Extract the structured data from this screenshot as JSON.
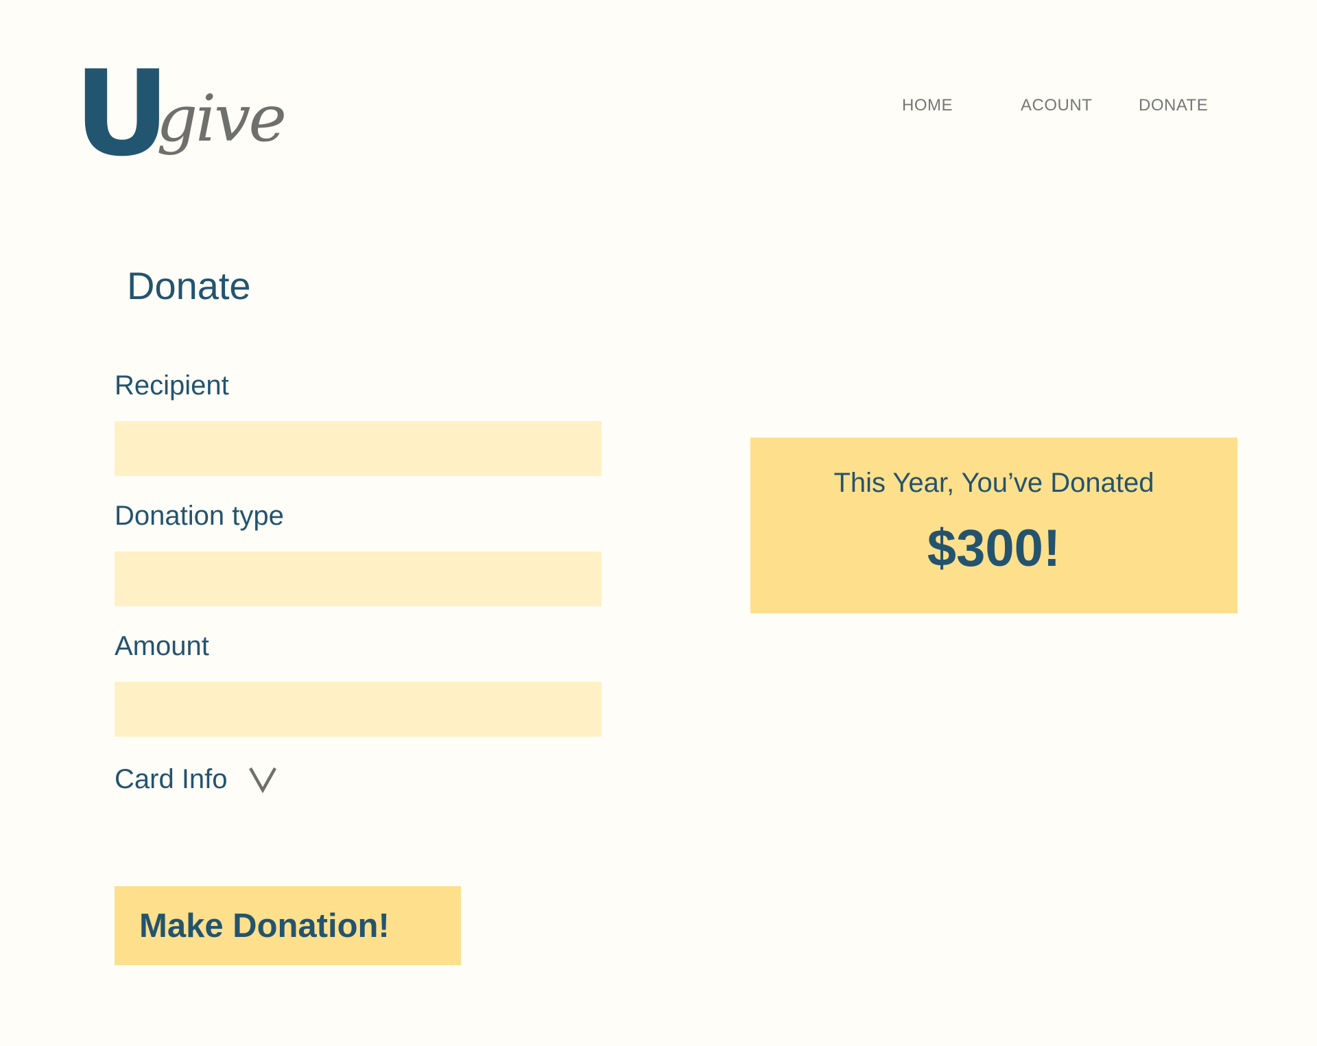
{
  "logo": {
    "primary_letter": "U",
    "secondary_text": "give"
  },
  "nav": {
    "items": [
      {
        "label": "HOME"
      },
      {
        "label": "ACOUNT"
      },
      {
        "label": "DONATE"
      }
    ]
  },
  "page": {
    "title": "Donate"
  },
  "form": {
    "recipient": {
      "label": "Recipient",
      "value": "",
      "placeholder": ""
    },
    "donation_type": {
      "label": "Donation type",
      "value": "",
      "placeholder": ""
    },
    "amount": {
      "label": "Amount",
      "value": "",
      "placeholder": ""
    },
    "card_info": {
      "label": "Card Info",
      "icon": "chevron-down-icon"
    },
    "submit_label": "Make Donation!"
  },
  "summary": {
    "label": "This Year, You’ve Donated",
    "amount": "$300!"
  },
  "colors": {
    "background": "#fefdf7",
    "primary_text": "#24536e",
    "logo_gray": "#6f6f6e",
    "nav_text": "#767676",
    "input_fill": "#fff1c5",
    "accent_yellow": "#fedf8c"
  }
}
